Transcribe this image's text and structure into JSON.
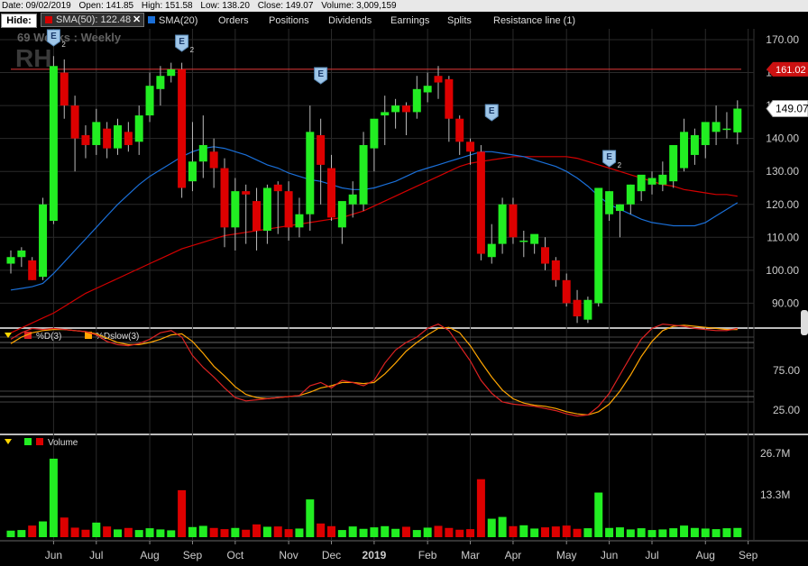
{
  "infobar": {
    "date": "Date: 09/02/2019",
    "open": "Open: 141.85",
    "high": "High: 151.58",
    "low": "Low: 138.20",
    "close": "Close: 149.07",
    "volume": "Volume: 3,009,159"
  },
  "toolbar": {
    "hide": "Hide:",
    "sma50": "SMA(50): 122.48",
    "sma50_close": "✕",
    "sma20": "SMA(20)",
    "items": [
      "Orders",
      "Positions",
      "Dividends",
      "Earnings",
      "Splits",
      "Resistance line (1)"
    ]
  },
  "watermark": {
    "period": "69  Weeks : Weekly",
    "symbol": "RH"
  },
  "colors": {
    "up": "#22ee22",
    "down": "#dd0000",
    "sma20": "#1a6fd8",
    "sma50": "#d40000",
    "stoch_d": "#dd2222",
    "stoch_dslow": "#ffa500",
    "resistance": "#cc3333"
  },
  "price_labels": {
    "resistance": "161.02",
    "last": "149.07"
  },
  "stoch_panel": {
    "d_label": "%D(3)",
    "dslow_label": "%Dslow(3)",
    "ticks": [
      "75.00",
      "25.00"
    ]
  },
  "volume_panel": {
    "label": "Volume",
    "ticks": [
      "26.7M",
      "13.3M"
    ]
  },
  "icons": {
    "earnings": "earnings-marker-icon",
    "collapse": "collapse-triangle-icon",
    "scroll": "scroll-handle-icon"
  },
  "chart_data": [
    {
      "type": "candlestick",
      "title": "RH",
      "period": "Weekly",
      "x_labels": [
        "Jun",
        "Jul",
        "Aug",
        "Sep",
        "Oct",
        "Nov",
        "Dec",
        "2019",
        "Feb",
        "Mar",
        "Apr",
        "May",
        "Jun",
        "Jul",
        "Aug",
        "Sep"
      ],
      "x_label_week": [
        4,
        8,
        13,
        17,
        21,
        26,
        30,
        34,
        39,
        43,
        47,
        52,
        56,
        60,
        65,
        69
      ],
      "y_ticks": [
        170,
        160,
        150,
        140,
        130,
        120,
        110,
        100,
        90
      ],
      "ylim": [
        82,
        173
      ],
      "ohlc": [
        [
          102,
          106,
          99,
          104
        ],
        [
          104,
          107,
          101,
          106
        ],
        [
          103,
          104,
          97,
          97
        ],
        [
          98,
          122,
          97,
          120
        ],
        [
          115,
          165,
          114,
          162
        ],
        [
          160,
          164,
          146,
          150
        ],
        [
          150,
          153,
          130,
          140
        ],
        [
          141,
          144,
          134,
          138
        ],
        [
          138,
          149,
          135,
          145
        ],
        [
          143,
          145,
          134,
          137
        ],
        [
          137,
          146,
          135,
          144
        ],
        [
          142,
          145,
          136,
          138
        ],
        [
          139,
          150,
          135,
          147
        ],
        [
          147,
          160,
          145,
          156
        ],
        [
          155,
          162,
          150,
          159
        ],
        [
          159,
          163,
          157,
          161
        ],
        [
          161,
          163,
          122,
          125
        ],
        [
          127,
          145,
          124,
          133
        ],
        [
          133,
          147,
          128,
          138
        ],
        [
          136,
          140,
          125,
          131
        ],
        [
          131,
          134,
          107,
          113
        ],
        [
          113,
          128,
          106,
          124
        ],
        [
          124,
          126,
          108,
          123
        ],
        [
          121,
          125,
          106,
          112
        ],
        [
          112,
          126,
          108,
          125
        ],
        [
          126,
          127,
          111,
          124
        ],
        [
          124,
          127,
          109,
          113
        ],
        [
          113,
          122,
          110,
          117
        ],
        [
          117,
          150,
          112,
          142
        ],
        [
          141,
          146,
          120,
          132
        ],
        [
          131,
          135,
          115,
          116
        ],
        [
          113,
          119,
          108,
          121
        ],
        [
          120,
          127,
          116,
          123
        ],
        [
          120,
          142,
          118,
          138
        ],
        [
          137,
          140,
          130,
          146
        ],
        [
          147,
          153,
          138,
          148
        ],
        [
          148,
          152,
          143,
          150
        ],
        [
          150,
          151,
          141,
          148
        ],
        [
          148,
          159,
          146,
          155
        ],
        [
          154,
          160,
          151,
          156
        ],
        [
          159,
          162,
          152,
          157
        ],
        [
          158,
          159,
          139,
          146
        ],
        [
          146,
          147,
          135,
          139
        ],
        [
          139,
          140,
          132,
          136
        ],
        [
          136,
          138,
          103,
          105
        ],
        [
          104,
          114,
          102,
          108
        ],
        [
          108,
          122,
          105,
          120
        ],
        [
          120,
          122,
          108,
          110
        ],
        [
          109,
          112,
          104,
          109
        ],
        [
          108,
          110,
          105,
          111
        ],
        [
          107,
          110,
          100,
          102
        ],
        [
          103,
          104,
          95,
          97
        ],
        [
          97,
          99,
          89,
          90
        ],
        [
          91,
          94,
          84,
          86
        ],
        [
          85,
          92,
          84,
          91
        ],
        [
          90,
          123,
          89,
          125
        ],
        [
          117,
          124,
          115,
          124
        ],
        [
          118,
          120,
          110,
          120
        ],
        [
          120,
          126,
          117,
          126
        ],
        [
          124,
          128,
          121,
          129
        ],
        [
          126,
          130,
          123,
          128
        ],
        [
          126,
          133,
          124,
          129
        ],
        [
          127,
          135,
          125,
          138
        ],
        [
          131,
          146,
          130,
          142
        ],
        [
          135,
          143,
          132,
          141
        ],
        [
          138,
          144,
          134,
          145
        ],
        [
          142,
          150,
          138,
          145
        ],
        [
          143,
          148,
          140,
          143
        ],
        [
          141.85,
          151.58,
          138.2,
          149.07
        ]
      ],
      "sma20": [
        94,
        94.5,
        95,
        96,
        99,
        102.5,
        106,
        109.5,
        113,
        116.5,
        120,
        123,
        126,
        128.5,
        130.5,
        132.5,
        134.5,
        136,
        137,
        137.5,
        137,
        136,
        135,
        133.5,
        132,
        131,
        129.5,
        128.5,
        127.5,
        127,
        126,
        125,
        124.5,
        124.5,
        125,
        126,
        127,
        128.5,
        130,
        131,
        132,
        133,
        134,
        135,
        136,
        136,
        135.5,
        135,
        134.5,
        133.5,
        132.5,
        131.5,
        130,
        128,
        125.5,
        122.5,
        120,
        118.5,
        117,
        115.5,
        114.5,
        114,
        113.5,
        113.5,
        113.5,
        114.5,
        116.5,
        118.5,
        120.5
      ],
      "sma50": [
        81,
        82.5,
        84,
        85.5,
        87,
        89,
        91,
        93,
        94.5,
        96,
        97.5,
        99,
        100.5,
        102,
        103.5,
        105,
        106.5,
        107.5,
        108.5,
        109.5,
        110.5,
        111,
        111.5,
        112,
        112.5,
        113,
        113.5,
        114,
        114.5,
        115,
        115.5,
        116,
        117,
        118,
        119.5,
        121,
        122.5,
        124,
        125.5,
        127,
        128.5,
        130,
        131.5,
        132.5,
        133,
        133.5,
        134,
        134.5,
        134.5,
        134.5,
        134.5,
        134.5,
        134.5,
        134,
        133,
        132,
        131,
        130,
        129,
        128,
        127,
        126,
        125.5,
        124.5,
        124,
        123.5,
        123,
        123,
        122.48
      ],
      "resistance": 161.02
    },
    {
      "type": "line",
      "series_names": [
        "%D(3)",
        "%Dslow(3)"
      ],
      "ylim": [
        0,
        100
      ],
      "y_ticks": [
        75,
        25
      ],
      "d": [
        78,
        84,
        88,
        87,
        88,
        87,
        86,
        85,
        82,
        76,
        73,
        72,
        74,
        78,
        84,
        86,
        80,
        63,
        52,
        43,
        33,
        24,
        21,
        22,
        23,
        24,
        25,
        26,
        35,
        38,
        33,
        40,
        38,
        35,
        40,
        56,
        68,
        75,
        80,
        88,
        92,
        86,
        72,
        58,
        40,
        28,
        20,
        18,
        17,
        16,
        14,
        12,
        9,
        7,
        8,
        16,
        28,
        45,
        62,
        78,
        88,
        92,
        91,
        90,
        88,
        87,
        86,
        86,
        88
      ],
      "dslow": [
        74,
        80,
        84,
        86,
        87,
        87,
        86,
        85,
        83,
        79,
        75,
        73,
        73,
        75,
        78,
        82,
        83,
        76,
        65,
        53,
        44,
        34,
        27,
        24,
        23,
        24,
        25,
        26,
        29,
        33,
        35,
        38,
        38,
        37,
        38,
        46,
        56,
        67,
        75,
        82,
        88,
        89,
        84,
        72,
        57,
        43,
        31,
        23,
        19,
        17,
        16,
        14,
        11,
        9,
        8,
        11,
        18,
        30,
        45,
        62,
        76,
        86,
        90,
        91,
        90,
        89,
        88,
        87,
        87
      ]
    },
    {
      "type": "bar",
      "name": "Volume",
      "unit": "M",
      "ylim": [
        0,
        28.5
      ],
      "y_ticks": [
        26.7,
        13.3
      ],
      "values": [
        2.2,
        2.4,
        3.9,
        5.3,
        26.4,
        6.6,
        3.2,
        2.5,
        4.9,
        3.6,
        2.6,
        3.1,
        2.4,
        3.0,
        2.6,
        2.3,
        15.8,
        3.4,
        3.8,
        3.1,
        2.7,
        3.1,
        2.5,
        4.3,
        3.5,
        3.6,
        2.7,
        2.9,
        12.7,
        4.6,
        3.7,
        2.4,
        3.6,
        2.8,
        3.3,
        3.7,
        2.8,
        3.5,
        2.4,
        3.2,
        3.8,
        3.1,
        2.5,
        2.7,
        19.5,
        6.2,
        6.8,
        3.7,
        4.0,
        2.9,
        3.3,
        3.6,
        3.9,
        2.8,
        3.0,
        15.0,
        3.1,
        3.3,
        2.6,
        3.0,
        2.4,
        2.6,
        3.0,
        3.9,
        3.1,
        2.9,
        2.7,
        3.0,
        3.1
      ]
    }
  ]
}
